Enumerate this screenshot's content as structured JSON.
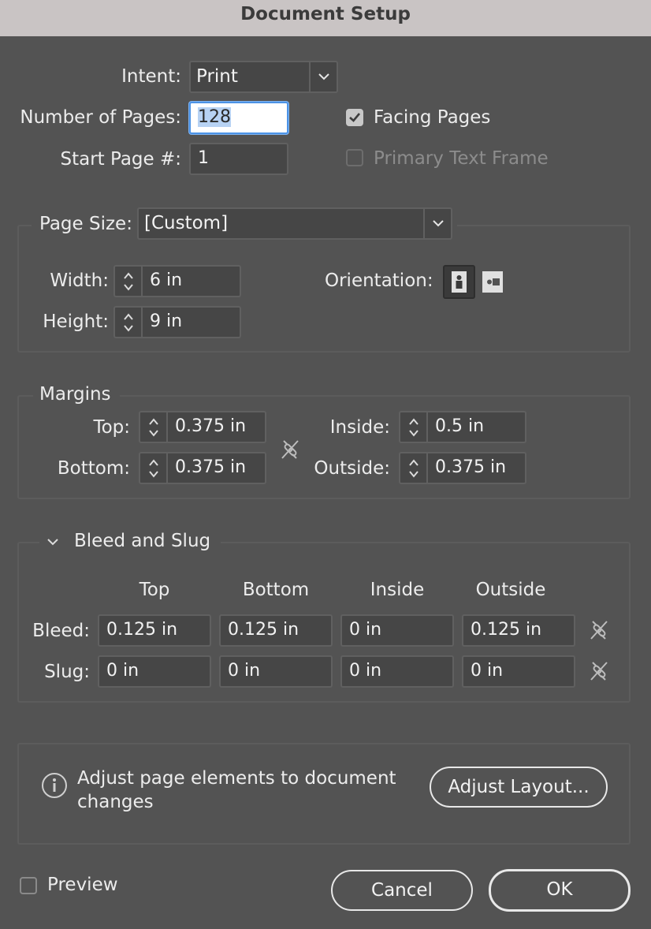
{
  "window": {
    "title": "Document Setup"
  },
  "intent": {
    "label": "Intent:",
    "value": "Print"
  },
  "pages": {
    "number_label": "Number of Pages:",
    "number_value": "128",
    "start_label": "Start Page #:",
    "start_value": "1",
    "facing_label": "Facing Pages",
    "facing_checked": true,
    "primary_frame_label": "Primary Text Frame",
    "primary_frame_checked": false
  },
  "page_size": {
    "label": "Page Size:",
    "value": "[Custom]",
    "width_label": "Width:",
    "width_value": "6 in",
    "height_label": "Height:",
    "height_value": "9 in",
    "orientation_label": "Orientation:"
  },
  "margins": {
    "heading": "Margins",
    "top_label": "Top:",
    "top_value": "0.375 in",
    "bottom_label": "Bottom:",
    "bottom_value": "0.375 in",
    "inside_label": "Inside:",
    "inside_value": "0.5 in",
    "outside_label": "Outside:",
    "outside_value": "0.375 in"
  },
  "bleed_slug": {
    "heading": "Bleed and Slug",
    "columns": [
      "Top",
      "Bottom",
      "Inside",
      "Outside"
    ],
    "bleed_label": "Bleed:",
    "bleed_values": [
      "0.125 in",
      "0.125 in",
      "0 in",
      "0.125 in"
    ],
    "slug_label": "Slug:",
    "slug_values": [
      "0 in",
      "0 in",
      "0 in",
      "0 in"
    ]
  },
  "adjust": {
    "info_line1": "Adjust page elements to document",
    "info_line2": "changes",
    "button_label": "Adjust Layout..."
  },
  "footer": {
    "preview_label": "Preview",
    "preview_checked": false,
    "cancel_label": "Cancel",
    "ok_label": "OK"
  },
  "colors": {
    "dialog_bg": "#535353",
    "titlebar_bg": "#c9c4c4",
    "field_bg": "#464646",
    "focus_ring": "#4c93e6"
  }
}
